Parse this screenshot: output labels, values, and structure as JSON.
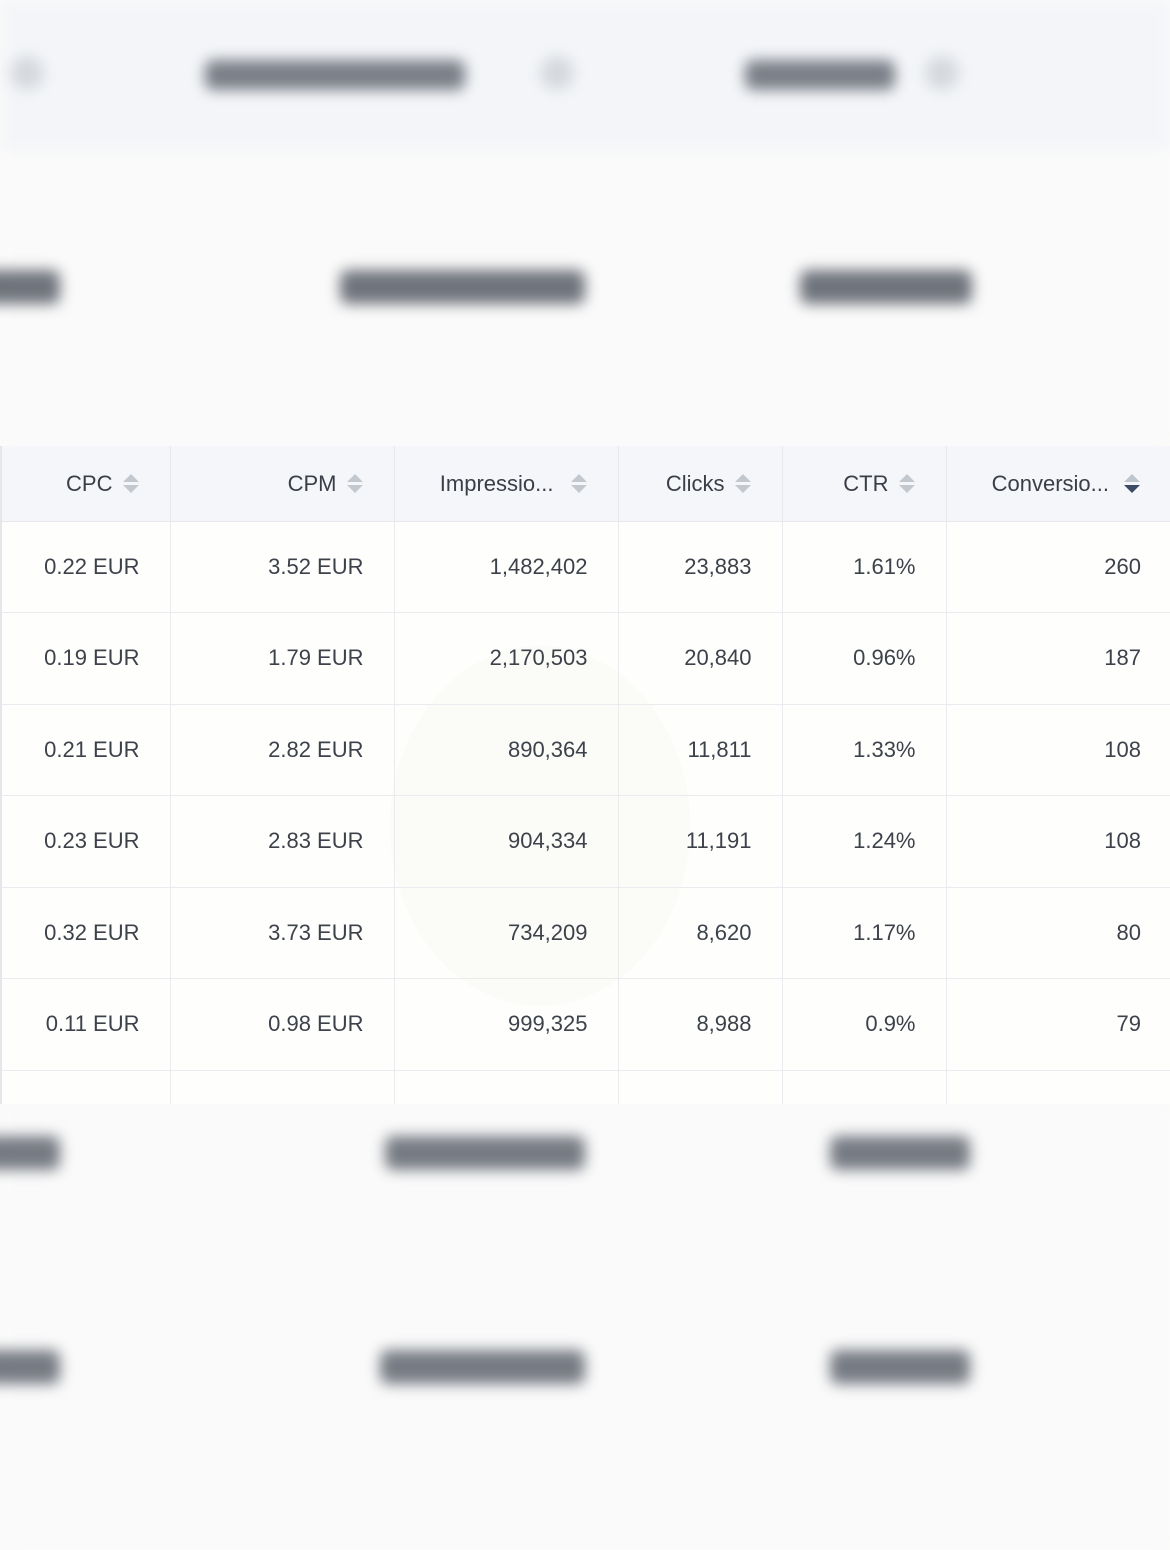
{
  "table": {
    "columns": [
      {
        "label": "CPC",
        "sort": "none"
      },
      {
        "label": "CPM",
        "sort": "none"
      },
      {
        "label": "Impressio...",
        "sort": "none"
      },
      {
        "label": "Clicks",
        "sort": "none"
      },
      {
        "label": "CTR",
        "sort": "none"
      },
      {
        "label": "Conversio...",
        "sort": "descending"
      }
    ],
    "rows": [
      [
        "0.22 EUR",
        "3.52 EUR",
        "1,482,402",
        "23,883",
        "1.61%",
        "260"
      ],
      [
        "0.19 EUR",
        "1.79 EUR",
        "2,170,503",
        "20,840",
        "0.96%",
        "187"
      ],
      [
        "0.21 EUR",
        "2.82 EUR",
        "890,364",
        "11,811",
        "1.33%",
        "108"
      ],
      [
        "0.23 EUR",
        "2.83 EUR",
        "904,334",
        "11,191",
        "1.24%",
        "108"
      ],
      [
        "0.32 EUR",
        "3.73 EUR",
        "734,209",
        "8,620",
        "1.17%",
        "80"
      ],
      [
        "0.11 EUR",
        "0.98 EUR",
        "999,325",
        "8,988",
        "0.9%",
        "79"
      ]
    ]
  },
  "colors": {
    "header_background": "#f4f6f9",
    "active_sort": "#3d4a63",
    "inactive_sort": "#c3c8cf"
  }
}
